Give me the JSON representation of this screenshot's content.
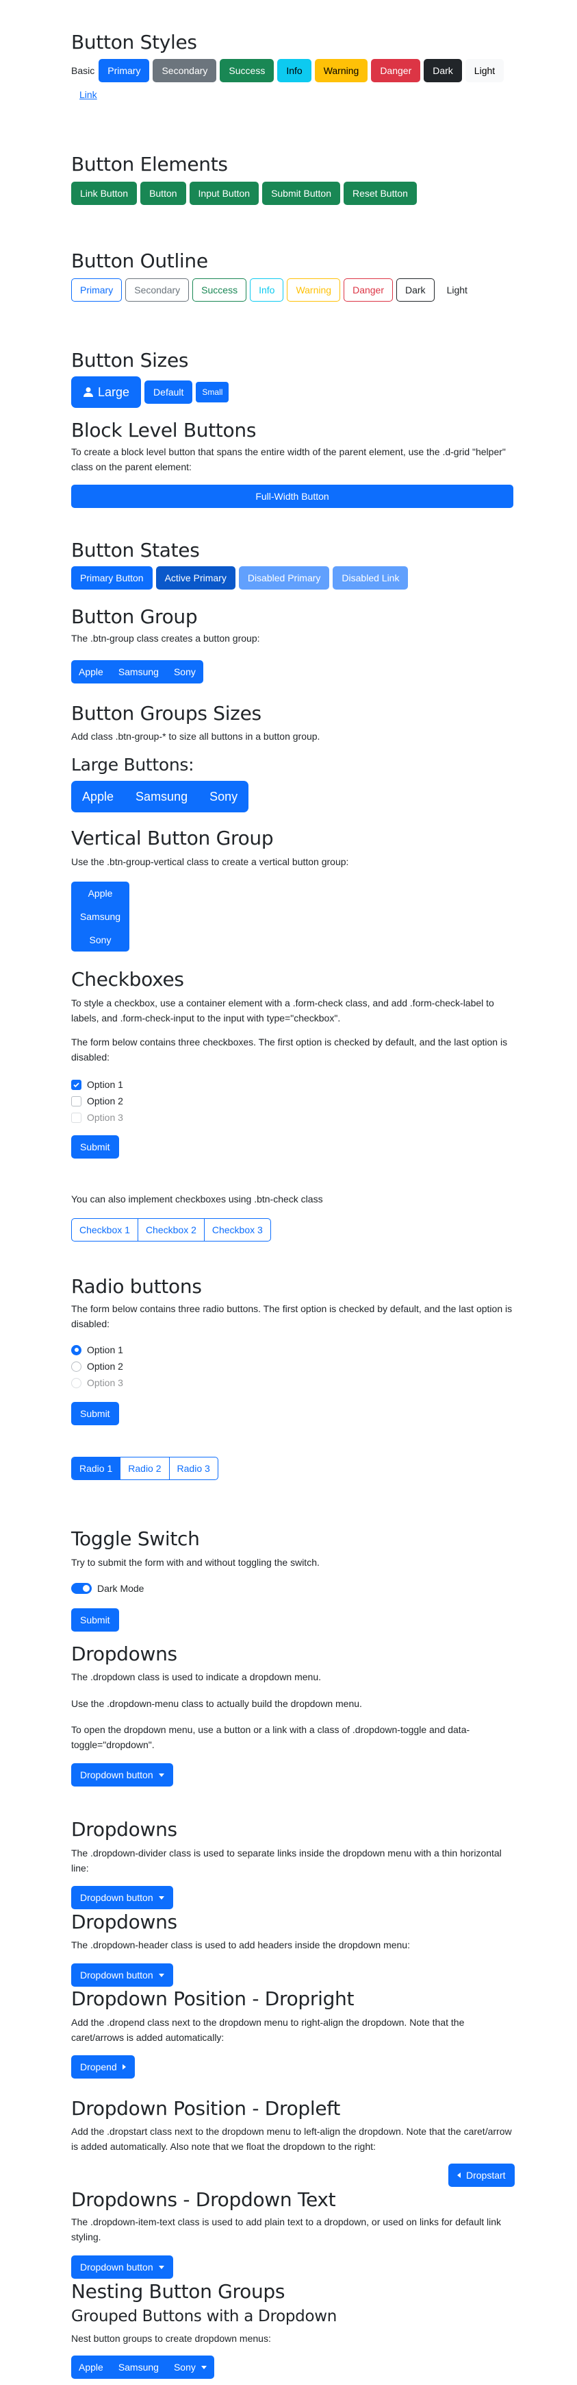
{
  "button_styles": {
    "title": "Button Styles",
    "basic": "Basic",
    "primary": "Primary",
    "secondary": "Secondary",
    "success": "Success",
    "info": "Info",
    "warning": "Warning",
    "danger": "Danger",
    "dark": "Dark",
    "light": "Light",
    "link": "Link"
  },
  "button_elements": {
    "title": "Button Elements",
    "items": [
      "Link Button",
      "Button",
      "Input Button",
      "Submit Button",
      "Reset Button"
    ]
  },
  "button_outline": {
    "title": "Button Outline",
    "items": [
      "Primary",
      "Secondary",
      "Success",
      "Info",
      "Warning",
      "Danger",
      "Dark",
      "Light"
    ]
  },
  "button_sizes": {
    "title": "Button Sizes",
    "large": "Large",
    "default": "Default",
    "small": "Small"
  },
  "block_level": {
    "title": "Block Level Buttons",
    "text": "To create a block level button that spans the entire width of the parent element, use the .d-grid \"helper\" class on the parent element:",
    "button": "Full-Width Button"
  },
  "button_states": {
    "title": "Button States",
    "items": [
      "Primary Button",
      "Active Primary",
      "Disabled Primary",
      "Disabled Link"
    ]
  },
  "button_group": {
    "title": "Button Group",
    "text": "The .btn-group class creates a button group:",
    "items": [
      "Apple",
      "Samsung",
      "Sony"
    ]
  },
  "group_sizes": {
    "title": "Button Groups Sizes",
    "text": "Add class .btn-group-* to size all buttons in a button group.",
    "subtitle": "Large Buttons:",
    "items": [
      "Apple",
      "Samsung",
      "Sony"
    ]
  },
  "vertical_group": {
    "title": "Vertical Button Group",
    "text": "Use the .btn-group-vertical class to create a vertical button group:",
    "items": [
      "Apple",
      "Samsung",
      "Sony"
    ]
  },
  "checkboxes": {
    "title": "Checkboxes",
    "text1": "To style a checkbox, use a container element with a .form-check class, and add .form-check-label to labels, and .form-check-input to the input with type=\"checkbox\".",
    "text2": "The form below contains three checkboxes. The first option is checked by default, and the last option is disabled:",
    "options": [
      "Option 1",
      "Option 2",
      "Option 3"
    ],
    "submit": "Submit",
    "btn_check_text": "You can also implement checkboxes using .btn-check class",
    "btn_checks": [
      "Checkbox 1",
      "Checkbox 2",
      "Checkbox 3"
    ]
  },
  "radios": {
    "title": "Radio buttons",
    "text": "The form below contains three radio buttons. The first option is checked by default, and the last option is disabled:",
    "options": [
      "Option 1",
      "Option 2",
      "Option 3"
    ],
    "submit": "Submit",
    "btn_radios": [
      "Radio 1",
      "Radio 2",
      "Radio 3"
    ]
  },
  "toggle": {
    "title": "Toggle Switch",
    "text": "Try to submit the form with and without toggling the switch.",
    "label": "Dark Mode",
    "submit": "Submit"
  },
  "dropdowns1": {
    "title": "Dropdowns",
    "text1": "The .dropdown class is used to indicate a dropdown menu.",
    "text2": "Use the .dropdown-menu class to actually build the dropdown menu.",
    "text3": "To open the dropdown menu, use a button or a link with a class of .dropdown-toggle and data-toggle=\"dropdown\".",
    "button": "Dropdown button"
  },
  "dropdowns2": {
    "title": "Dropdowns",
    "text": "The .dropdown-divider class is used to separate links inside the dropdown menu with a thin horizontal line:",
    "button": "Dropdown button"
  },
  "dropdowns3": {
    "title": "Dropdowns",
    "text": "The .dropdown-header class is used to add headers inside the dropdown menu:",
    "button": "Dropdown button"
  },
  "dropright": {
    "title": "Dropdown Position - Dropright",
    "text": "Add the .dropend class next to the dropdown menu to right-align the dropdown. Note that the caret/arrows is added automatically:",
    "button": "Dropend"
  },
  "dropleft": {
    "title": "Dropdown Position - Dropleft",
    "text": "Add the .dropstart class next to the dropdown menu to left-align the dropdown. Note that the caret/arrow is added automatically. Also note that we float the dropdown to the right:",
    "button": "Dropstart"
  },
  "dropdown_text": {
    "title": "Dropdowns - Dropdown Text",
    "text": "The .dropdown-item-text class is used to add plain text to a dropdown, or used on links for default link styling.",
    "button": "Dropdown button"
  },
  "nesting": {
    "title": "Nesting Button Groups",
    "subtitle": "Grouped Buttons with a Dropdown",
    "text": "Nest button groups to create dropdown menus:",
    "items": [
      "Apple",
      "Samsung",
      "Sony"
    ]
  },
  "colors": {
    "primary": "#0d6efd",
    "secondary": "#6c757d",
    "success": "#198754",
    "info": "#0dcaf0",
    "warning": "#ffc107",
    "danger": "#dc3545",
    "dark": "#212529",
    "light": "#f8f9fa"
  }
}
